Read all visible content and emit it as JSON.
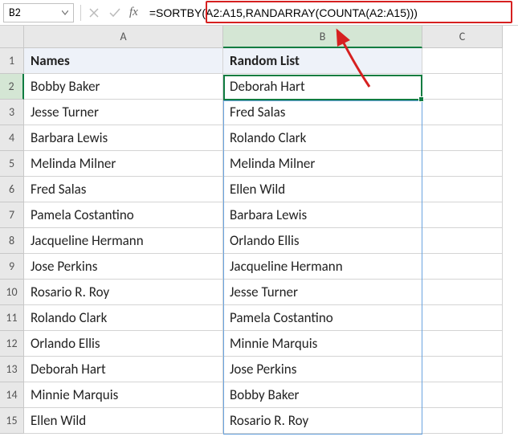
{
  "name_box": {
    "value": "B2"
  },
  "formula_bar": {
    "fx_label": "fx",
    "formula": "=SORTBY(A2:A15,RANDARRAY(COUNTA(A2:A15)))"
  },
  "columns": [
    "A",
    "B",
    "C"
  ],
  "headers": {
    "a": "Names",
    "b": "Random List"
  },
  "rows": [
    {
      "n": "1",
      "a": "Names",
      "b": "Random List",
      "header": true
    },
    {
      "n": "2",
      "a": "Bobby Baker",
      "b": "Deborah Hart"
    },
    {
      "n": "3",
      "a": "Jesse Turner",
      "b": "Fred Salas"
    },
    {
      "n": "4",
      "a": "Barbara Lewis",
      "b": "Rolando Clark"
    },
    {
      "n": "5",
      "a": "Melinda Milner",
      "b": "Melinda Milner"
    },
    {
      "n": "6",
      "a": "Fred Salas",
      "b": "Ellen Wild"
    },
    {
      "n": "7",
      "a": "Pamela Costantino",
      "b": "Barbara Lewis"
    },
    {
      "n": "8",
      "a": "Jacqueline Hermann",
      "b": "Orlando Ellis"
    },
    {
      "n": "9",
      "a": "Jose Perkins",
      "b": "Jacqueline Hermann"
    },
    {
      "n": "10",
      "a": "Rosario R. Roy",
      "b": "Jesse Turner"
    },
    {
      "n": "11",
      "a": "Rolando Clark",
      "b": "Pamela Costantino"
    },
    {
      "n": "12",
      "a": "Orlando Ellis",
      "b": "Minnie Marquis"
    },
    {
      "n": "13",
      "a": "Deborah Hart",
      "b": "Jose Perkins"
    },
    {
      "n": "14",
      "a": "Minnie Marquis",
      "b": "Bobby Baker"
    },
    {
      "n": "15",
      "a": "Ellen Wild",
      "b": "Rosario R. Roy"
    }
  ],
  "active_cell": "B2"
}
